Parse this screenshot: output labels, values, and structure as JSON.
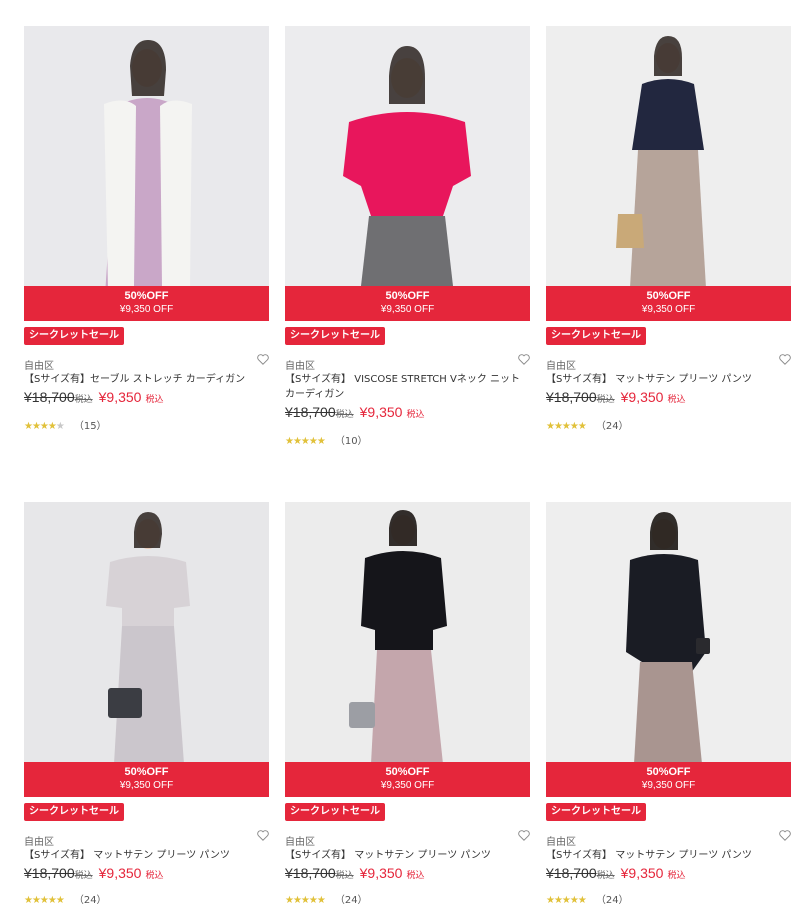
{
  "accent_color": "#e5263b",
  "star_color": "#e1c13a",
  "products": [
    {
      "band_pct": "50%OFF",
      "band_price": "¥9,350 OFF",
      "secret_label": "シークレットセール",
      "brand": "自由区",
      "name": "【Sサイズ有】セーブル ストレッチ カーディガン",
      "orig_price": "¥18,700",
      "orig_tax": "税込",
      "sale_price": "¥9,350",
      "sale_tax": "税込",
      "stars": "★★★★",
      "stars_off": "★",
      "rating_value": 4,
      "review_count": "（15）",
      "icons": [
        "heart-icon"
      ],
      "photo": {
        "bg": "#e9e9ec",
        "top": "#f4f4f2",
        "bottom": "#c9a7c8"
      }
    },
    {
      "band_pct": "50%OFF",
      "band_price": "¥9,350 OFF",
      "secret_label": "シークレットセール",
      "brand": "自由区",
      "name": "【Sサイズ有】 VISCOSE STRETCH Vネック ニット カーディガン",
      "orig_price": "¥18,700",
      "orig_tax": "税込",
      "sale_price": "¥9,350",
      "sale_tax": "税込",
      "stars": "★★★★★",
      "stars_off": "",
      "rating_value": 4.5,
      "review_count": "（10）",
      "icons": [
        "heart-icon"
      ],
      "photo": {
        "bg": "#ececee",
        "top": "#e8165c",
        "bottom": "#6f6f72"
      }
    },
    {
      "band_pct": "50%OFF",
      "band_price": "¥9,350 OFF",
      "secret_label": "シークレットセール",
      "brand": "自由区",
      "name": "【Sサイズ有】 マットサテン プリーツ パンツ",
      "orig_price": "¥18,700",
      "orig_tax": "税込",
      "sale_price": "¥9,350",
      "sale_tax": "税込",
      "stars": "★★★★★",
      "stars_off": "",
      "rating_value": 4.5,
      "review_count": "（24）",
      "icons": [
        "heart-icon"
      ],
      "photo": {
        "bg": "#eeeeee",
        "top": "#22273f",
        "bottom": "#b6a49a"
      }
    },
    {
      "band_pct": "50%OFF",
      "band_price": "¥9,350 OFF",
      "secret_label": "シークレットセール",
      "brand": "自由区",
      "name": "【Sサイズ有】 マットサテン プリーツ パンツ",
      "orig_price": "¥18,700",
      "orig_tax": "税込",
      "sale_price": "¥9,350",
      "sale_tax": "税込",
      "stars": "★★★★★",
      "stars_off": "",
      "rating_value": 4.5,
      "review_count": "（24）",
      "icons": [
        "heart-icon"
      ],
      "photo": {
        "bg": "#e7e7e9",
        "top": "#d7d2d6",
        "bottom": "#cbc6cc"
      }
    },
    {
      "band_pct": "50%OFF",
      "band_price": "¥9,350 OFF",
      "secret_label": "シークレットセール",
      "brand": "自由区",
      "name": "【Sサイズ有】 マットサテン プリーツ パンツ",
      "orig_price": "¥18,700",
      "orig_tax": "税込",
      "sale_price": "¥9,350",
      "sale_tax": "税込",
      "stars": "★★★★★",
      "stars_off": "",
      "rating_value": 4.5,
      "review_count": "（24）",
      "icons": [
        "heart-icon"
      ],
      "photo": {
        "bg": "#ececec",
        "top": "#15151a",
        "bottom": "#c4a6ac"
      }
    },
    {
      "band_pct": "50%OFF",
      "band_price": "¥9,350 OFF",
      "secret_label": "シークレットセール",
      "brand": "自由区",
      "name": "【Sサイズ有】 マットサテン プリーツ パンツ",
      "orig_price": "¥18,700",
      "orig_tax": "税込",
      "sale_price": "¥9,350",
      "sale_tax": "税込",
      "stars": "★★★★★",
      "stars_off": "",
      "rating_value": 4.5,
      "review_count": "（24）",
      "icons": [
        "heart-icon"
      ],
      "photo": {
        "bg": "#eeeeee",
        "top": "#1a1c24",
        "bottom": "#a99590"
      }
    }
  ]
}
